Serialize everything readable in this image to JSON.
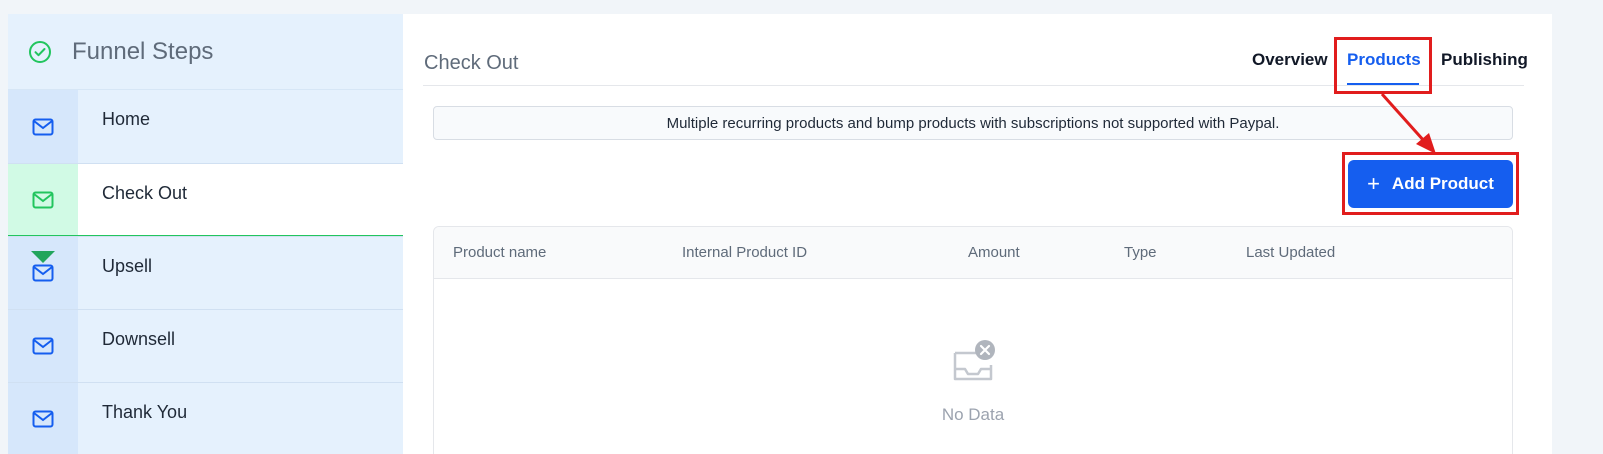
{
  "sidebar": {
    "title": "Funnel Steps",
    "steps": [
      {
        "label": "Home"
      },
      {
        "label": "Check Out"
      },
      {
        "label": "Upsell"
      },
      {
        "label": "Downsell"
      },
      {
        "label": "Thank You"
      }
    ],
    "active_step": "Check Out"
  },
  "main": {
    "title": "Check Out",
    "tabs": [
      {
        "label": "Overview"
      },
      {
        "label": "Products"
      },
      {
        "label": "Publishing"
      }
    ],
    "active_tab": "Products",
    "notice": "Multiple recurring products and bump products with subscriptions not supported with Paypal.",
    "add_button_label": "Add Product",
    "table": {
      "columns": [
        "Product name",
        "Internal Product ID",
        "Amount",
        "Type",
        "Last Updated"
      ],
      "rows": [],
      "empty_text": "No Data"
    }
  },
  "colors": {
    "primary": "#155eef",
    "active_green": "#22c55e",
    "sidebar_bg": "#e5f1fd",
    "annotation_red": "#e11d1d"
  },
  "icons": {
    "header": "check-circle-icon",
    "step": "envelope-icon",
    "add": "plus-icon",
    "empty": "empty-inbox-icon"
  }
}
